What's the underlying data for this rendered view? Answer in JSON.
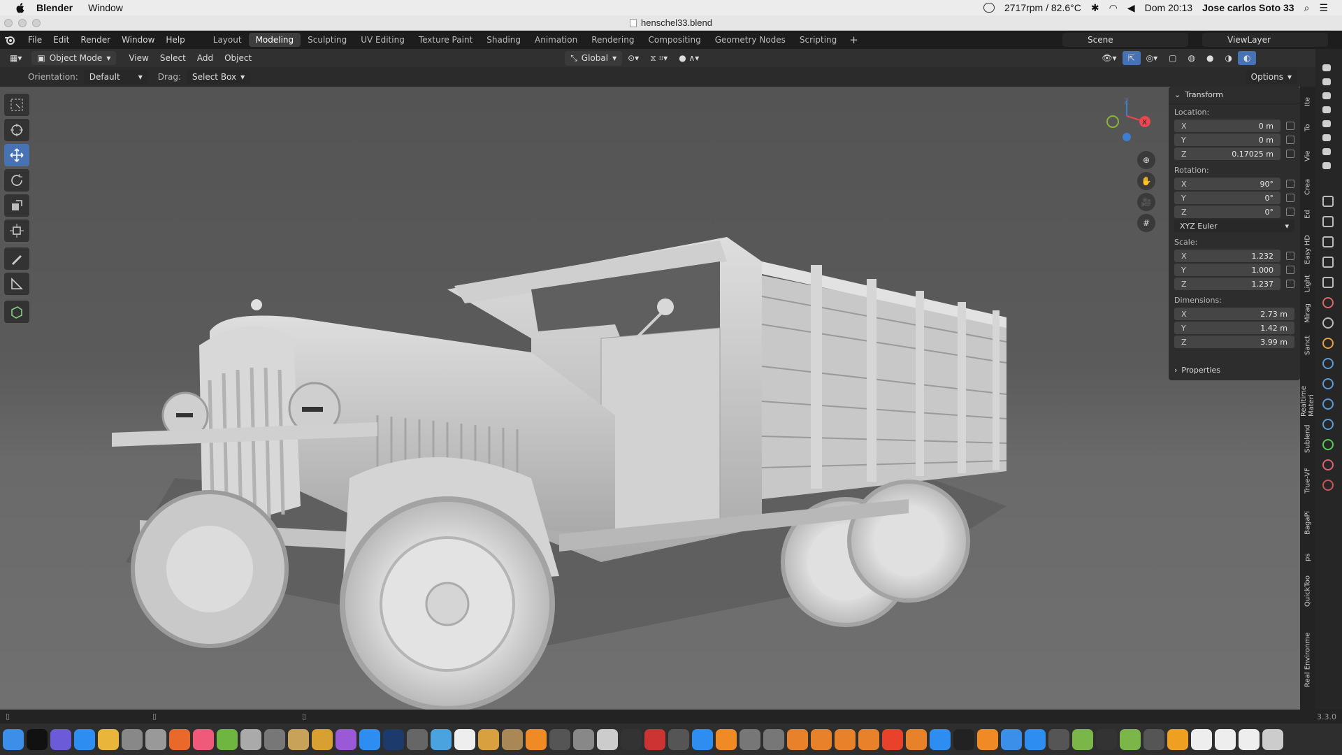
{
  "macbar": {
    "app": "Blender",
    "menu": [
      "Window"
    ],
    "status": "2717rpm / 82.6°C",
    "clock": "Dom 20:13",
    "user": "Jose carlos Soto 33"
  },
  "window": {
    "title": "henschel33.blend"
  },
  "topbar": {
    "menus": [
      "File",
      "Edit",
      "Render",
      "Window",
      "Help"
    ],
    "workspaces": [
      "Layout",
      "Modeling",
      "Sculpting",
      "UV Editing",
      "Texture Paint",
      "Shading",
      "Animation",
      "Rendering",
      "Compositing",
      "Geometry Nodes",
      "Scripting"
    ],
    "active_workspace": "Modeling",
    "scene": "Scene",
    "view_layer": "ViewLayer"
  },
  "header": {
    "mode": "Object Mode",
    "menus": [
      "View",
      "Select",
      "Add",
      "Object"
    ],
    "transform_orientation": "Global"
  },
  "toolsettings": {
    "orientation_label": "Orientation:",
    "orientation_value": "Default",
    "drag_label": "Drag:",
    "drag_value": "Select Box",
    "options": "Options"
  },
  "gizmo": {
    "x": "X",
    "y": "Y",
    "z": "Z"
  },
  "npanel": {
    "title": "Transform",
    "location_label": "Location:",
    "location": {
      "x": "0 m",
      "y": "0 m",
      "z": "0.17025 m"
    },
    "rotation_label": "Rotation:",
    "rotation": {
      "x": "90°",
      "y": "0°",
      "z": "0°"
    },
    "rotation_mode": "XYZ Euler",
    "scale_label": "Scale:",
    "scale": {
      "x": "1.232",
      "y": "1.000",
      "z": "1.237"
    },
    "dimensions_label": "Dimensions:",
    "dimensions": {
      "x": "2.73 m",
      "y": "1.42 m",
      "z": "3.99 m"
    },
    "properties": "Properties"
  },
  "side_tabs": [
    "Ite",
    "To",
    "Vie",
    "Crea",
    "Ed",
    "Easy HD",
    "Light",
    "Mirag",
    "Sanct",
    "Realtime Materi",
    "Sublend",
    "True-VF",
    "BagaPi",
    "ps",
    "QuickToo",
    "Real Environme"
  ],
  "status": {
    "version": "3.3.0"
  },
  "colors": {
    "accent": "#4772b3",
    "axis_x": "#e8484f",
    "axis_y": "#8bb535",
    "axis_z": "#3d7ecf"
  }
}
